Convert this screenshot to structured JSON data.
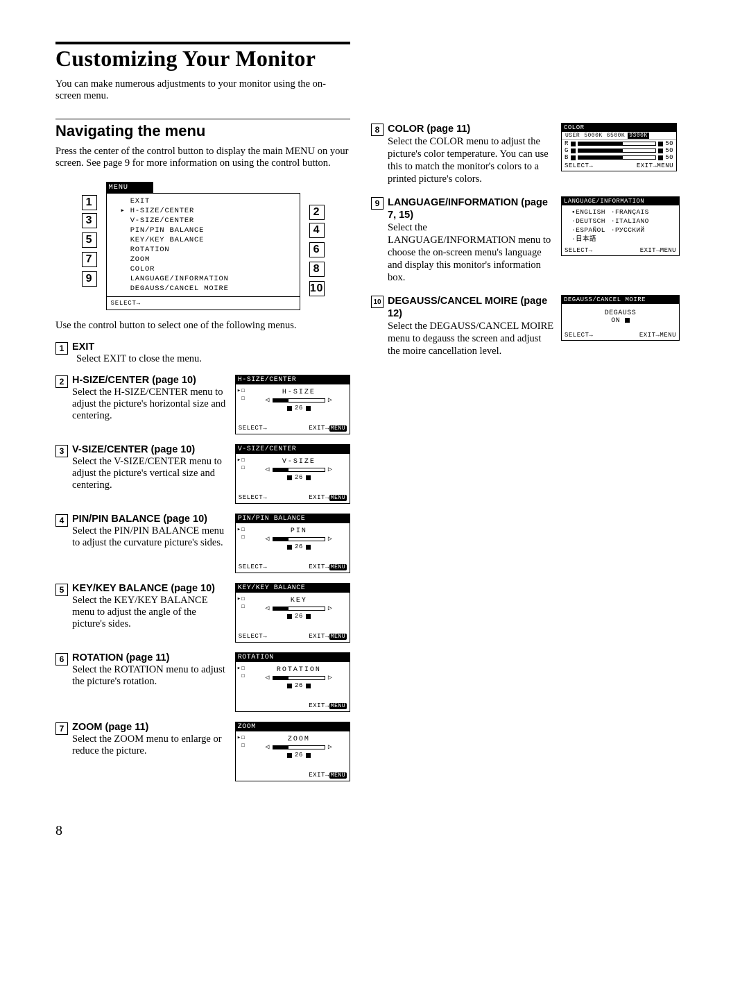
{
  "page_number": "8",
  "title": "Customizing Your Monitor",
  "intro": "You can make numerous adjustments to your monitor using the on-screen menu.",
  "nav": {
    "heading": "Navigating the menu",
    "para": "Press the center of the control button to display the main MENU on your screen. See page 9 for more information on using the control button.",
    "use_control": "Use the control button to select one of the following menus."
  },
  "main_menu": {
    "title": "MENU",
    "items": [
      "EXIT",
      "H-SIZE/CENTER",
      "V-SIZE/CENTER",
      "PIN/PIN BALANCE",
      "KEY/KEY BALANCE",
      "ROTATION",
      "ZOOM",
      "COLOR",
      "LANGUAGE/INFORMATION",
      "DEGAUSS/CANCEL MOIRE"
    ],
    "foot": "SELECT→"
  },
  "items": [
    {
      "n": "1",
      "title": "EXIT",
      "desc": "Select EXIT to close the menu."
    },
    {
      "n": "2",
      "title": "H-SIZE/CENTER (page 10)",
      "desc": "Select the H-SIZE/CENTER menu to adjust the picture's horizontal size and centering.",
      "osd": {
        "title": "H-SIZE/CENTER",
        "label": "H-SIZE",
        "value": "26"
      }
    },
    {
      "n": "3",
      "title": "V-SIZE/CENTER (page 10)",
      "desc": "Select the V-SIZE/CENTER menu to adjust the picture's vertical size and centering.",
      "osd": {
        "title": "V-SIZE/CENTER",
        "label": "V-SIZE",
        "value": "26"
      }
    },
    {
      "n": "4",
      "title": "PIN/PIN BALANCE (page 10)",
      "desc": "Select the PIN/PIN BALANCE menu to adjust the curvature picture's sides.",
      "osd": {
        "title": "PIN/PIN BALANCE",
        "label": "PIN",
        "value": "26"
      }
    },
    {
      "n": "5",
      "title": "KEY/KEY BALANCE (page 10)",
      "desc": "Select the KEY/KEY BALANCE menu to adjust the angle of the picture's sides.",
      "osd": {
        "title": "KEY/KEY BALANCE",
        "label": "KEY",
        "value": "26"
      }
    },
    {
      "n": "6",
      "title": "ROTATION (page 11)",
      "desc": "Select the ROTATION menu to adjust the picture's rotation.",
      "osd": {
        "title": "ROTATION",
        "label": "ROTATION",
        "value": "26"
      }
    },
    {
      "n": "7",
      "title": "ZOOM (page 11)",
      "desc": "Select the ZOOM menu to enlarge or reduce the picture.",
      "osd": {
        "title": "ZOOM",
        "label": "ZOOM",
        "value": "26"
      }
    }
  ],
  "right_items": [
    {
      "n": "8",
      "title": "COLOR (page 11)",
      "desc": "Select the COLOR menu to adjust the picture's color temperature. You can use this to match the monitor's colors to a printed picture's colors."
    },
    {
      "n": "9",
      "title": "LANGUAGE/INFORMATION (page 7, 15)",
      "desc": "Select the LANGUAGE/INFORMATION menu to choose the on-screen menu's language and display this monitor's information box."
    },
    {
      "n": "10",
      "title": "DEGAUSS/CANCEL MOIRE (page 12)",
      "desc": "Select the DEGAUSS/CANCEL MOIRE menu to degauss the screen and adjust the moire cancellation level."
    }
  ],
  "color_osd": {
    "title": "COLOR",
    "tabs": [
      "USER",
      "5000K",
      "6500K",
      "9300K"
    ],
    "rows": [
      {
        "ch": "R",
        "v": "50"
      },
      {
        "ch": "G",
        "v": "50"
      },
      {
        "ch": "B",
        "v": "50"
      }
    ],
    "foot_select": "SELECT→",
    "foot_exit": "EXIT→"
  },
  "lang_osd": {
    "title": "LANGUAGE/INFORMATION",
    "langs_col1": [
      "ENGLISH",
      "DEUTSCH",
      "ESPAÑOL",
      "日本語"
    ],
    "langs_col2": [
      "FRANÇAIS",
      "ITALIANO",
      "РУССКИЙ"
    ],
    "foot_select": "SELECT→",
    "foot_exit": "EXIT→"
  },
  "degauss_osd": {
    "title": "DEGAUSS/CANCEL MOIRE",
    "label": "DEGAUSS",
    "on": "ON",
    "foot_select": "SELECT→",
    "foot_exit": "EXIT→"
  },
  "osd_common": {
    "select": "SELECT→",
    "exit": "EXIT→",
    "menu": "MENU"
  }
}
